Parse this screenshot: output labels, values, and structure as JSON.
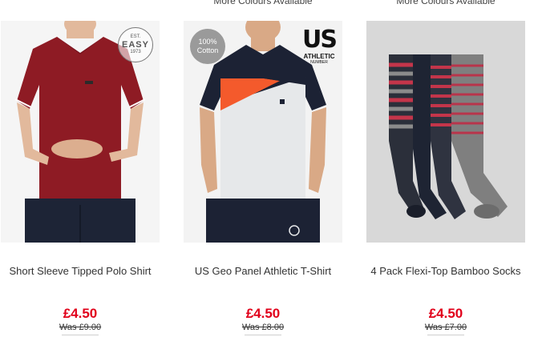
{
  "products": [
    {
      "name": "Short Sleeve Tipped Polo Shirt",
      "price": "£4.50",
      "was_price": "Was £9.00",
      "colours_note": "",
      "badge": {
        "top": "EST.",
        "main": "EASY",
        "bottom": "1973"
      }
    },
    {
      "name": "US Geo Panel Athletic T-Shirt",
      "price": "£4.50",
      "was_price": "Was £8.00",
      "colours_note": "More Colours Available",
      "badge": {
        "line1": "100%",
        "line2": "Cotton"
      },
      "brand_logo": {
        "big": "US",
        "small": "ATHLETIC",
        "tiny": "NUMBER"
      }
    },
    {
      "name": "4 Pack Flexi-Top Bamboo Socks",
      "price": "£4.50",
      "was_price": "Was £7.00",
      "colours_note": "More Colours Available"
    }
  ],
  "colors": {
    "price_red": "#e1001a",
    "polo_red": "#8e1b24",
    "navy": "#1c2234",
    "orange": "#f45a2c",
    "light_grey": "#e6e8ea"
  }
}
